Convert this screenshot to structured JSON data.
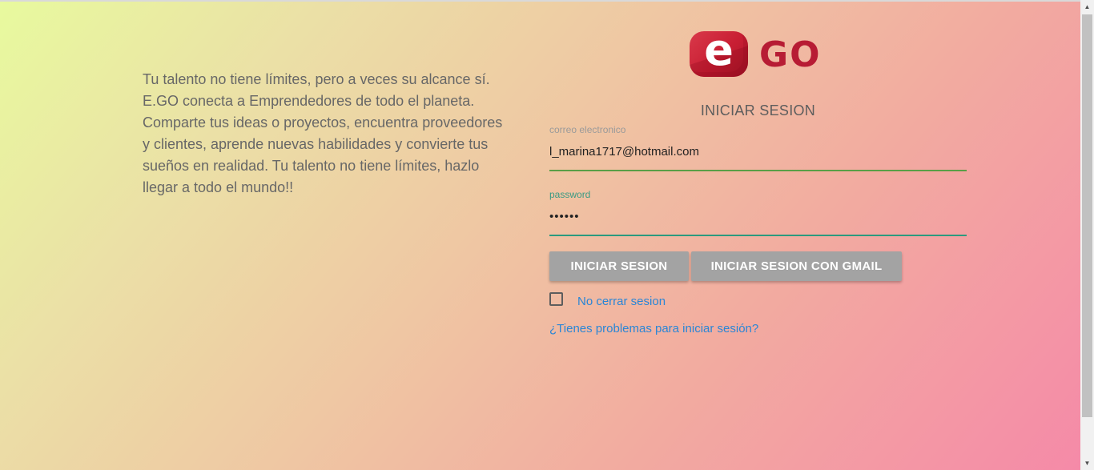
{
  "intro": {
    "lines": [
      "Tu talento no tiene límites, pero a veces su alcance sí.",
      "E.GO conecta a Emprendedores de todo el planeta.",
      "Comparte tus ideas o proyectos, encuentra proveedores",
      "y clientes, aprende nuevas habilidades y convierte tus",
      "sueños en realidad. Tu talento no tiene límites, hazlo",
      "llegar a todo el mundo!!"
    ]
  },
  "logo": {
    "e": "e",
    "go": "GO"
  },
  "login": {
    "title": "INICIAR SESION",
    "email_label": "correo electronico",
    "email_value": "l_marina1717@hotmail.com",
    "password_label": "password",
    "password_value": "••••••",
    "login_button": "INICIAR SESION",
    "gmail_button": "INICIAR SESION CON GMAIL",
    "remember_label": "No cerrar sesion",
    "remember_checked": false,
    "help_link": "¿Tienes problemas para iniciar sesión?"
  },
  "scrollbar": {
    "up_icon": "chevron-up-icon",
    "down_icon": "chevron-down-icon"
  },
  "colors": {
    "brand_red": "#b71c34",
    "link_blue": "#2a86d6",
    "button_gray": "#a3a3a3",
    "email_underline": "#5a9e46",
    "password_underline": "#2c9a7e"
  }
}
